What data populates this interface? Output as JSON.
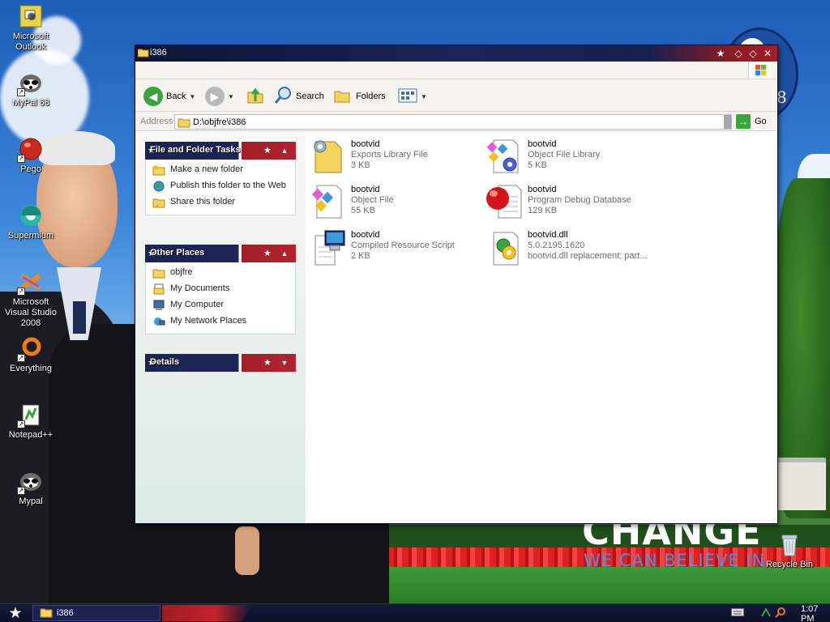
{
  "desktop": {
    "icons": [
      {
        "label": "Microsoft Outlook",
        "icon": "outlook-icon"
      },
      {
        "label": "MyPal 68",
        "icon": "raccoon-icon"
      },
      {
        "label": "Pego",
        "icon": "red-ball-icon"
      },
      {
        "label": "Supermium",
        "icon": "supermium-icon"
      },
      {
        "label": "Microsoft Visual Studio 2008",
        "icon": "visual-studio-icon"
      },
      {
        "label": "Everything",
        "icon": "magnifier-ring-icon"
      },
      {
        "label": "Notepad++",
        "icon": "notepad-plus-icon"
      },
      {
        "label": "Mypal",
        "icon": "raccoon-icon"
      }
    ],
    "recycle_bin": "Recycle Bin",
    "wallpaper_text": {
      "line1": "CHANGE",
      "line2": "WE CAN BELIEVE IN"
    }
  },
  "window": {
    "title": "i386",
    "toolbar": {
      "back": "Back",
      "search": "Search",
      "folders": "Folders"
    },
    "address": {
      "label": "Address",
      "value": "D:\\objfre\\i386",
      "go": "Go"
    },
    "panels": {
      "tasks": {
        "title": "File and Folder Tasks",
        "items": [
          "Make a new folder",
          "Publish this folder to the Web",
          "Share this folder"
        ]
      },
      "places": {
        "title": "Other Places",
        "items": [
          "objfre",
          "My Documents",
          "My Computer",
          "My Network Places"
        ]
      },
      "details": {
        "title": "Details"
      }
    },
    "files": [
      {
        "name": "bootvid",
        "type": "Exports Library File",
        "size": "3 KB",
        "icon": "exports-library-icon"
      },
      {
        "name": "bootvid",
        "type": "Object File Library",
        "size": "5 KB",
        "icon": "object-library-icon"
      },
      {
        "name": "bootvid",
        "type": "Object File",
        "size": "55 KB",
        "icon": "object-file-icon"
      },
      {
        "name": "bootvid",
        "type": "Program Debug Database",
        "size": "129 KB",
        "icon": "debug-database-icon"
      },
      {
        "name": "bootvid",
        "type": "Compiled Resource Script",
        "size": "2 KB",
        "icon": "resource-script-icon"
      },
      {
        "name": "bootvid.dll",
        "type": "5.0.2195.1620",
        "size": "bootvid.dll replacement; part...",
        "icon": "dll-icon"
      }
    ]
  },
  "taskbar": {
    "task_label": "i386",
    "clock": "1:07 PM"
  },
  "colors": {
    "title_navy": "#1a2456",
    "panel_red": "#a11e28",
    "accent_green": "#38a83a"
  }
}
